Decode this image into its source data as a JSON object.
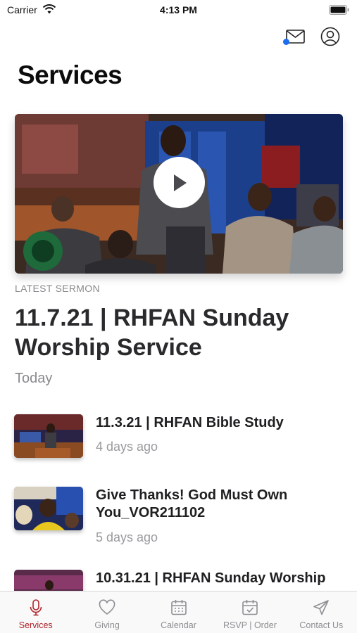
{
  "status_bar": {
    "carrier": "Carrier",
    "time": "4:13 PM"
  },
  "header": {
    "title": "Services",
    "has_unread_messages": true
  },
  "featured": {
    "label": "LATEST SERMON",
    "title": "11.7.21 | RHFAN Sunday Worship Service",
    "date": "Today"
  },
  "sermons": [
    {
      "title": "11.3.21 | RHFAN Bible Study",
      "date": "4 days ago"
    },
    {
      "title": "Give Thanks! God Must Own You_VOR211102",
      "date": "5 days ago"
    },
    {
      "title": "10.31.21 | RHFAN Sunday Worship",
      "date": ""
    }
  ],
  "tabs": [
    {
      "label": "Services",
      "icon": "microphone-icon",
      "active": true
    },
    {
      "label": "Giving",
      "icon": "heart-icon",
      "active": false
    },
    {
      "label": "Calendar",
      "icon": "calendar-icon",
      "active": false
    },
    {
      "label": "RSVP | Order",
      "icon": "calendar-check-icon",
      "active": false
    },
    {
      "label": "Contact Us",
      "icon": "paper-plane-icon",
      "active": false
    }
  ],
  "colors": {
    "accent": "#b1222a",
    "unread_dot": "#1e6cf0",
    "secondary_text": "#8a8a8e"
  }
}
